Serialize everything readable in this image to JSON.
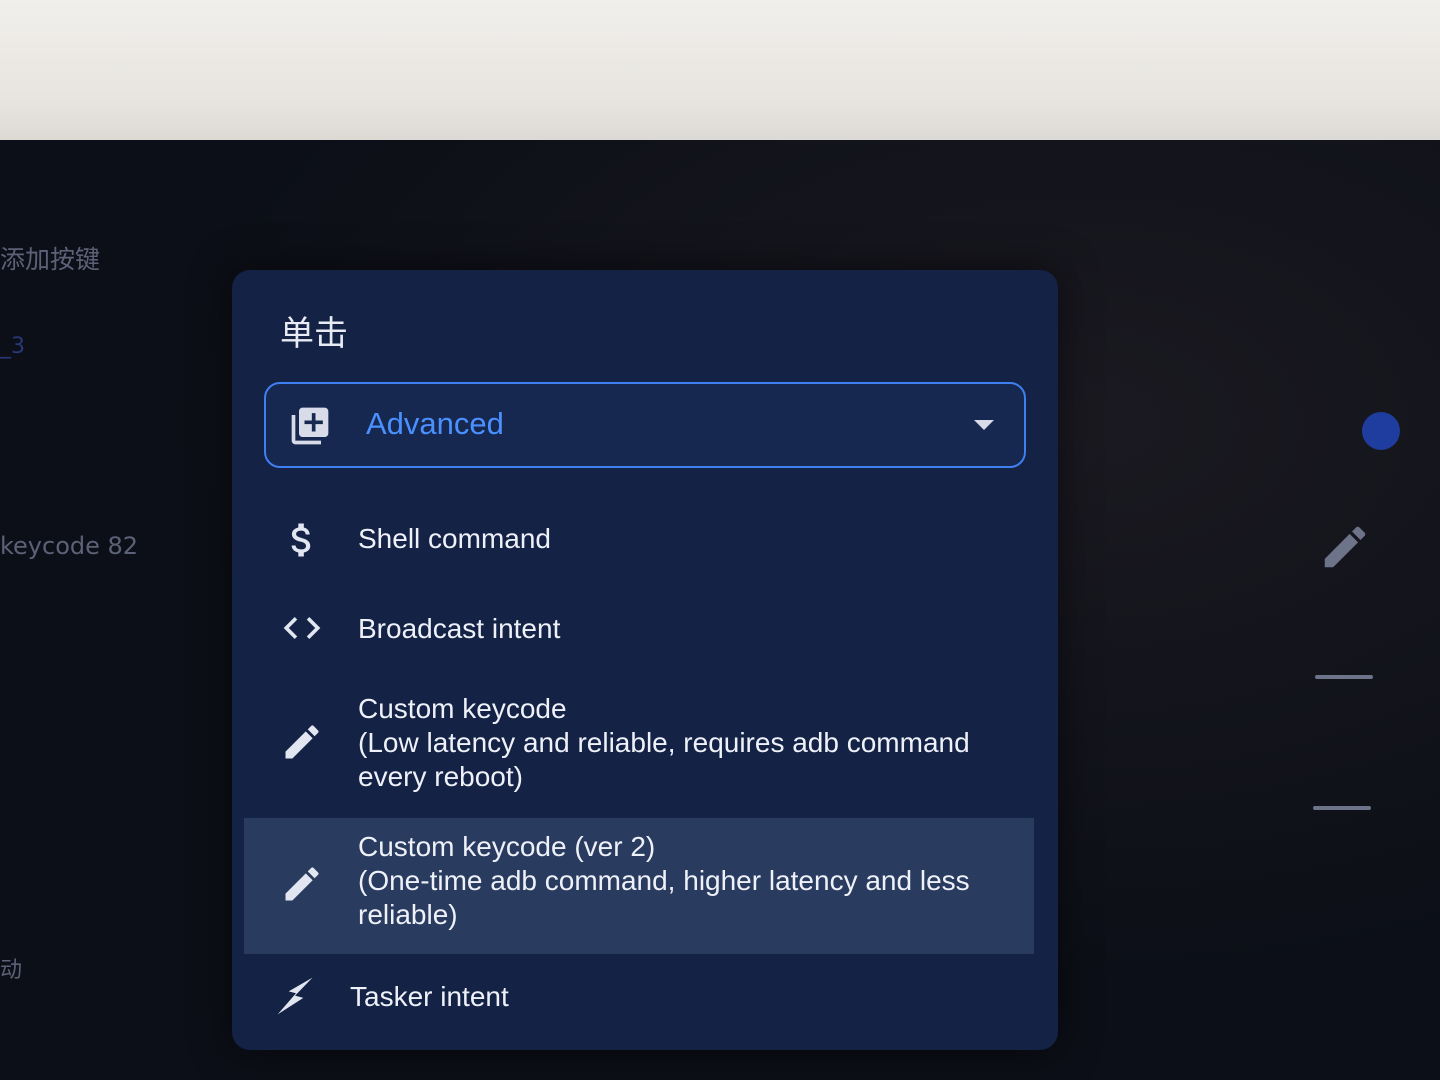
{
  "background_screen": {
    "title": "添加按键",
    "item_number": "_3",
    "keycode_label": "keycode 82",
    "glyph": "动"
  },
  "dialog": {
    "title": "单击",
    "dropdown": {
      "icon": "library-add-icon",
      "selected_label": "Advanced",
      "accent_color": "#4a90ff"
    },
    "options": [
      {
        "icon": "dollar-icon",
        "label": "Shell command"
      },
      {
        "icon": "code-brackets-icon",
        "label": "Broadcast intent"
      },
      {
        "icon": "pencil-icon",
        "label": "Custom keycode\n(Low latency and reliable, requires adb command\nevery reboot)"
      },
      {
        "icon": "pencil-icon",
        "label": "Custom keycode (ver 2)\n(One-time adb command, higher latency and less\nreliable)",
        "highlighted": true
      },
      {
        "icon": "tasker-bolt-icon",
        "label": "Tasker intent"
      }
    ]
  }
}
